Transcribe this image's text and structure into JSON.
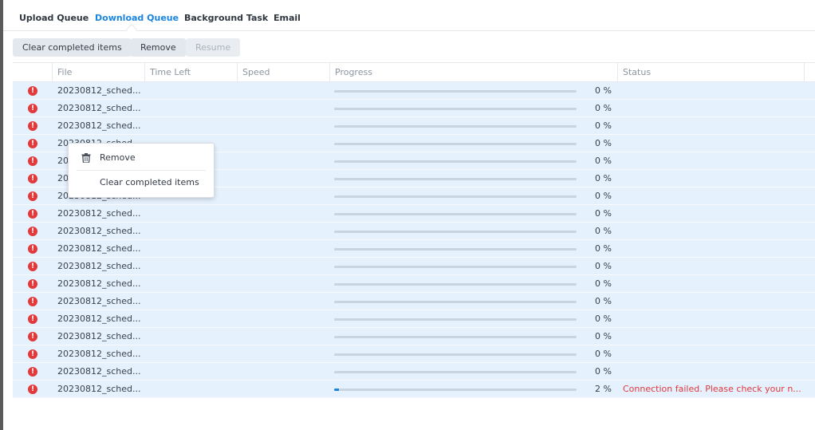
{
  "tabs": [
    {
      "label": "Upload Queue",
      "active": false
    },
    {
      "label": "Download Queue",
      "active": true
    },
    {
      "label": "Background Task",
      "active": false
    },
    {
      "label": "Email",
      "active": false
    }
  ],
  "toolbar": {
    "clear_label": "Clear completed items",
    "remove_label": "Remove",
    "resume_label": "Resume"
  },
  "columns": [
    "File",
    "Time Left",
    "Speed",
    "Progress",
    "Status"
  ],
  "rows": [
    {
      "file": "20230812_sched...",
      "progress": 0,
      "pct": "0 %",
      "status": ""
    },
    {
      "file": "20230812_sched...",
      "progress": 0,
      "pct": "0 %",
      "status": ""
    },
    {
      "file": "20230812_sched...",
      "progress": 0,
      "pct": "0 %",
      "status": ""
    },
    {
      "file": "20230812_sched...",
      "progress": 0,
      "pct": "0 %",
      "status": ""
    },
    {
      "file": "20230812_sched...",
      "progress": 0,
      "pct": "0 %",
      "status": ""
    },
    {
      "file": "20230812_sched...",
      "progress": 0,
      "pct": "0 %",
      "status": ""
    },
    {
      "file": "20230812_sched...",
      "progress": 0,
      "pct": "0 %",
      "status": ""
    },
    {
      "file": "20230812_sched...",
      "progress": 0,
      "pct": "0 %",
      "status": ""
    },
    {
      "file": "20230812_sched...",
      "progress": 0,
      "pct": "0 %",
      "status": ""
    },
    {
      "file": "20230812_sched...",
      "progress": 0,
      "pct": "0 %",
      "status": ""
    },
    {
      "file": "20230812_sched...",
      "progress": 0,
      "pct": "0 %",
      "status": ""
    },
    {
      "file": "20230812_sched...",
      "progress": 0,
      "pct": "0 %",
      "status": ""
    },
    {
      "file": "20230812_sched...",
      "progress": 0,
      "pct": "0 %",
      "status": ""
    },
    {
      "file": "20230812_sched...",
      "progress": 0,
      "pct": "0 %",
      "status": ""
    },
    {
      "file": "20230812_sched...",
      "progress": 0,
      "pct": "0 %",
      "status": ""
    },
    {
      "file": "20230812_sched...",
      "progress": 0,
      "pct": "0 %",
      "status": ""
    },
    {
      "file": "20230812_sched...",
      "progress": 0,
      "pct": "0 %",
      "status": ""
    },
    {
      "file": "20230812_sched...",
      "progress": 0.02,
      "pct": "2 %",
      "status": "Connection failed. Please check your n..."
    }
  ],
  "row_icon": "error-icon",
  "context_menu": {
    "remove_label": "Remove",
    "remove_icon": "trash-icon",
    "clear_label": "Clear completed items"
  },
  "colors": {
    "accent": "#1a85df",
    "error": "#e0393e",
    "row_selected": "#e5f1fd"
  }
}
